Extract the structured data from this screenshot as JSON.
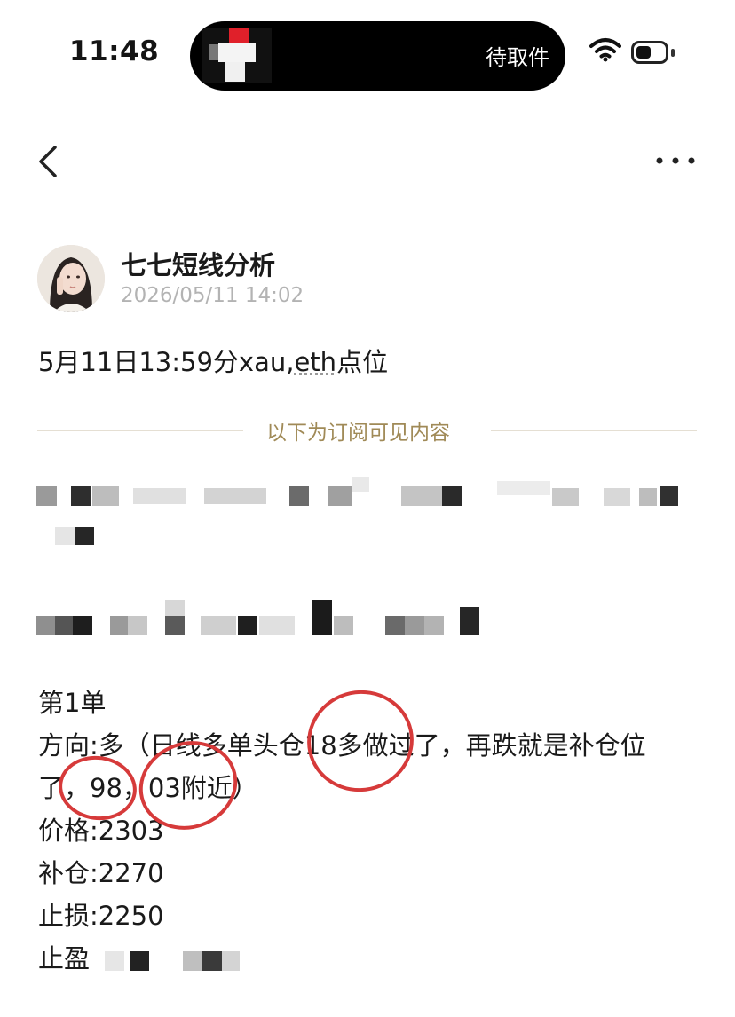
{
  "status_bar": {
    "time": "11:48",
    "island_label": "待取件",
    "wifi_icon": "wifi-icon",
    "battery_icon": "battery-icon"
  },
  "nav": {
    "back_icon": "chevron-left-icon",
    "back_glyph": "<",
    "more_icon": "more-horizontal-icon",
    "more_glyph": "···"
  },
  "post": {
    "author": "七七短线分析",
    "date": "2026/05/11 14:02",
    "title_prefix": "5月11日13:59分xau,",
    "title_underlined": "eth",
    "title_suffix": "点位",
    "divider_text": "以下为订阅可见内容",
    "order": {
      "heading": "第1单",
      "direction_line1": "方向:多（日线多单头仓18多做过了，再跌就是补仓位",
      "direction_line2": "了，98，03附近）",
      "price": "价格:2303",
      "add_position": "补仓:2270",
      "stop_loss": "止损:2250",
      "take_profit_label": "止盈"
    }
  },
  "colors": {
    "annotation_red": "#d63a3a",
    "divider_gold": "#a08a57",
    "date_gray": "#b3b3b3"
  }
}
